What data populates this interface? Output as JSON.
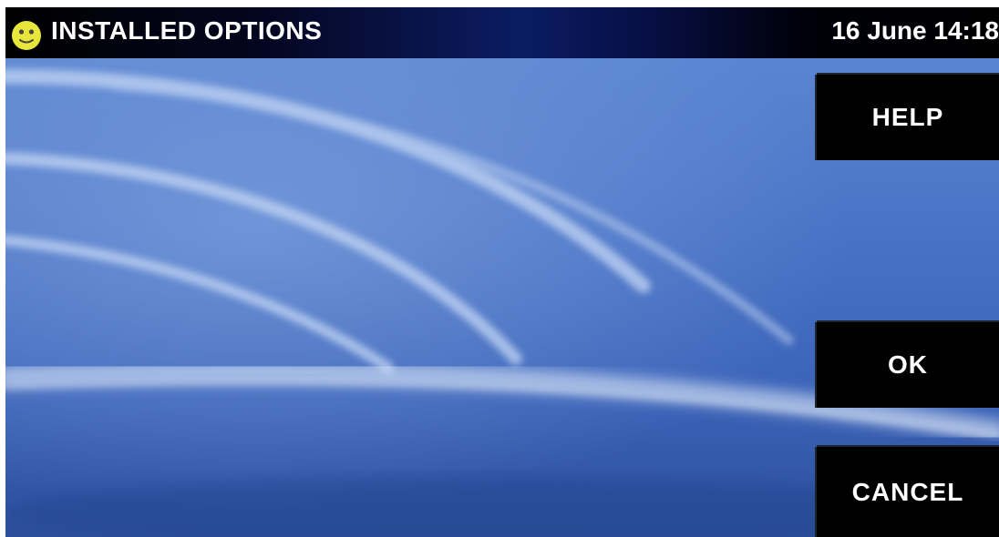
{
  "header": {
    "title": "INSTALLED OPTIONS",
    "datetime": "16 June 14:18",
    "icon": "smiley-status-icon"
  },
  "softkeys": {
    "help": "HELP",
    "ok": "OK",
    "cancel": "CANCEL"
  },
  "colors": {
    "background": "#3d67c1",
    "titlebar": "#000000",
    "accent": "#0b1c63",
    "button": "#000000",
    "text": "#ffffff",
    "icon": "#e8e63a"
  }
}
